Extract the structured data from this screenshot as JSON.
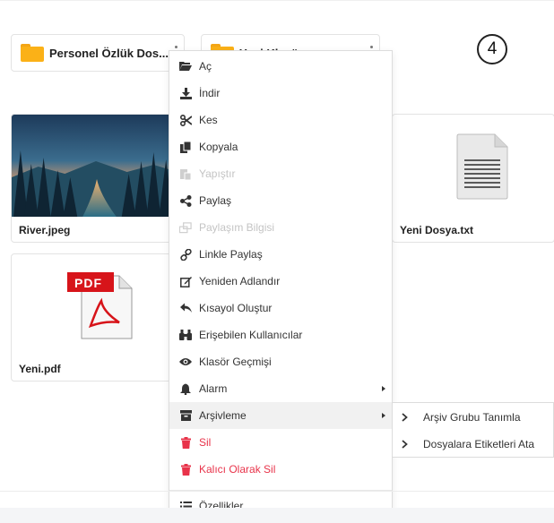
{
  "step_badge": "4",
  "folders": [
    {
      "label": "Personel Özlük Dos..."
    },
    {
      "label": "Yeni Klasör"
    }
  ],
  "files": [
    {
      "name": "River.jpeg"
    },
    {
      "name": "Yeni Dosya.txt"
    },
    {
      "name": "Yeni.pdf"
    }
  ],
  "pdf_badge": "PDF",
  "context_menu": {
    "items": [
      {
        "label": "Aç",
        "icon": "folder-open-icon"
      },
      {
        "label": "İndir",
        "icon": "download-icon"
      },
      {
        "label": "Kes",
        "icon": "scissors-icon"
      },
      {
        "label": "Kopyala",
        "icon": "copy-icon"
      },
      {
        "label": "Yapıştır",
        "icon": "paste-icon",
        "disabled": true
      },
      {
        "label": "Paylaş",
        "icon": "share-icon"
      },
      {
        "label": "Paylaşım Bilgisi",
        "icon": "share-info-icon",
        "disabled": true
      },
      {
        "label": "Linkle Paylaş",
        "icon": "link-icon"
      },
      {
        "label": "Yeniden Adlandır",
        "icon": "rename-icon"
      },
      {
        "label": "Kısayol Oluştur",
        "icon": "shortcut-icon"
      },
      {
        "label": "Erişebilen Kullanıcılar",
        "icon": "binoculars-icon"
      },
      {
        "label": "Klasör Geçmişi",
        "icon": "eye-icon"
      },
      {
        "label": "Alarm",
        "icon": "bell-icon",
        "submenu": true
      },
      {
        "label": "Arşivleme",
        "icon": "archive-icon",
        "submenu": true,
        "active": true
      },
      {
        "label": "Sil",
        "icon": "trash-icon",
        "danger": true
      },
      {
        "label": "Kalıcı Olarak Sil",
        "icon": "trash-icon",
        "danger": true
      },
      {
        "label": "Özellikler",
        "icon": "list-icon"
      }
    ]
  },
  "archive_submenu": {
    "items": [
      {
        "label": "Arşiv Grubu Tanımla"
      },
      {
        "label": "Dosyalara Etiketleri Ata"
      }
    ]
  },
  "colors": {
    "folder": "#fbb117",
    "danger": "#e8334a",
    "pdf_red": "#d7141a"
  }
}
